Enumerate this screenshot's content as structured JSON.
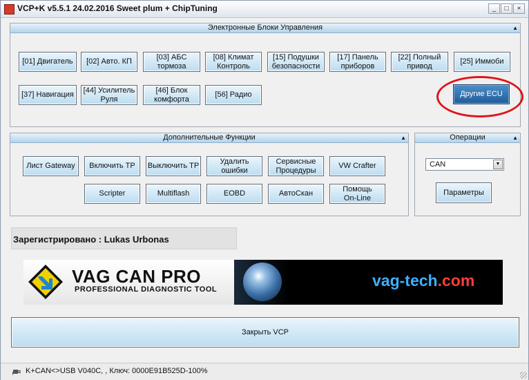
{
  "window": {
    "title": "VCP+K v5.5.1 24.02.2016 Sweet plum + ChipTuning",
    "minimize_glyph": "_",
    "restore_glyph": "□",
    "close_glyph": "×"
  },
  "ecu_panel": {
    "title": "Электронные Блоки Управления",
    "collapse_glyph": "▲",
    "buttons": [
      "[01] Двигатель",
      "[02] Авто. КП",
      "[03] АБС\nтормоза",
      "[08] Климат\nКонтроль",
      "[15] Подушки\nбезопасности",
      "[17] Панель\nприборов",
      "[22] Полный\nпривод",
      "[25] Иммоби",
      "[37] Навигация",
      "[44] Усилитель\nРуля",
      "[46] Блок\nкомфорта",
      "[56] Радио"
    ],
    "other_ecu": "Другие ECU"
  },
  "functions_panel": {
    "title": "Дополнительные Функции",
    "collapse_glyph": "▲",
    "buttons": [
      "Лист Gateway",
      "Включить TP",
      "Выключить TP",
      "Удалить\nошибки",
      "Сервисные\nПроцедуры",
      "VW Crafter",
      "Scripter",
      "Multiflash",
      "EOBD",
      "АвтоСкан",
      "Помощь\nOn-Line"
    ]
  },
  "operations_panel": {
    "title": "Операции",
    "collapse_glyph": "▲",
    "protocol_value": "CAN",
    "dropdown_glyph": "▼",
    "params_button": "Параметры"
  },
  "registration": "Зарегистрировано : Lukas Urbonas",
  "banner": {
    "brand": "VAG CAN PRO",
    "tagline": "PROFESSIONAL DIAGNOSTIC TOOL",
    "site_part1": "vag-tech",
    "site_part2": ".com"
  },
  "close_button": "Закрыть VCP",
  "status": "K+CAN<>USB V040C, , Ключ: 0000E91B525D-100%",
  "icons": {
    "app": "vcp-app-icon",
    "status": "usb-plug-icon",
    "logo": "vag-diamond-arrow-icon"
  },
  "colors": {
    "button_light": "#bcdcf0",
    "button_dark": "#1f5c99",
    "highlight_ring": "#e01418",
    "site_blue": "#3cb0ff",
    "site_red": "#ff3c3c",
    "logo_yellow": "#f2d000"
  }
}
